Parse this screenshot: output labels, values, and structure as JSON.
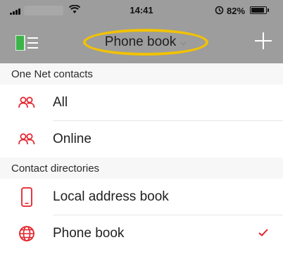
{
  "status_bar": {
    "time": "14:41",
    "battery_percent": "82%",
    "battery_level": 0.82,
    "icons": [
      "signal-icon",
      "wifi-icon",
      "alarm-icon",
      "battery-icon"
    ]
  },
  "nav": {
    "title": "Phone book",
    "icons": [
      "menu-panel-icon",
      "chevron-down-icon",
      "plus-icon"
    ]
  },
  "sections": [
    {
      "header": "One Net contacts",
      "items": [
        {
          "label": "All",
          "icon": "people-icon",
          "selected": false
        },
        {
          "label": "Online",
          "icon": "people-icon",
          "selected": false
        }
      ]
    },
    {
      "header": "Contact directories",
      "items": [
        {
          "label": "Local address book",
          "icon": "phone-device-icon",
          "selected": false
        },
        {
          "label": "Phone book",
          "icon": "globe-icon",
          "selected": true
        }
      ]
    }
  ],
  "colors": {
    "accent_red": "#e5202b",
    "header_gray": "#9d9d9d",
    "highlight_yellow": "#f2c200",
    "menu_icon_green": "#3cb44a"
  }
}
